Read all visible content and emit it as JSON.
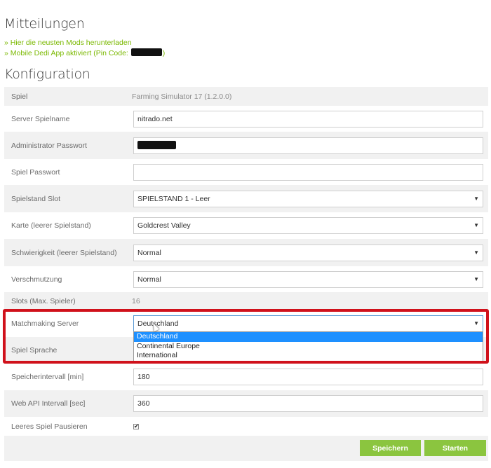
{
  "messages": {
    "title": "Mitteilungen",
    "links": [
      {
        "text": "» Hier die neusten Mods herunterladen"
      },
      {
        "text_before": "» Mobile Dedi App aktiviert (Pin Code: ",
        "text_after": ")"
      }
    ]
  },
  "config": {
    "title": "Konfiguration",
    "rows": {
      "game": {
        "label": "Spiel",
        "value": "Farming Simulator 17 (1.2.0.0)"
      },
      "server_name": {
        "label": "Server Spielname",
        "value": "nitrado.net"
      },
      "admin_password": {
        "label": "Administrator Passwort"
      },
      "game_password": {
        "label": "Spiel Passwort",
        "value": ""
      },
      "savegame_slot": {
        "label": "Spielstand Slot",
        "value": "SPIELSTAND 1 - Leer"
      },
      "map": {
        "label": "Karte (leerer Spielstand)",
        "value": "Goldcrest Valley"
      },
      "difficulty": {
        "label": "Schwierigkeit (leerer Spielstand)",
        "value": "Normal"
      },
      "pollution": {
        "label": "Verschmutzung",
        "value": "Normal"
      },
      "slots": {
        "label": "Slots (Max. Spieler)",
        "value": "16"
      },
      "matchmaking": {
        "label": "Matchmaking Server",
        "value": "Deutschland",
        "options": [
          "Deutschland",
          "Continental Europe",
          "International"
        ]
      },
      "language": {
        "label": "Spiel Sprache"
      },
      "save_interval": {
        "label": "Speicherintervall [min]",
        "value": "180"
      },
      "webapi_interval": {
        "label": "Web API Intervall [sec]",
        "value": "360"
      },
      "pause_empty": {
        "label": "Leeres Spiel Pausieren",
        "checked": true
      }
    }
  },
  "buttons": {
    "save": "Speichern",
    "start": "Starten"
  },
  "colors": {
    "accent_green": "#8bc53f",
    "link_green": "#7ab800",
    "highlight_red": "#d0111b",
    "selected_blue": "#1e90ff"
  }
}
